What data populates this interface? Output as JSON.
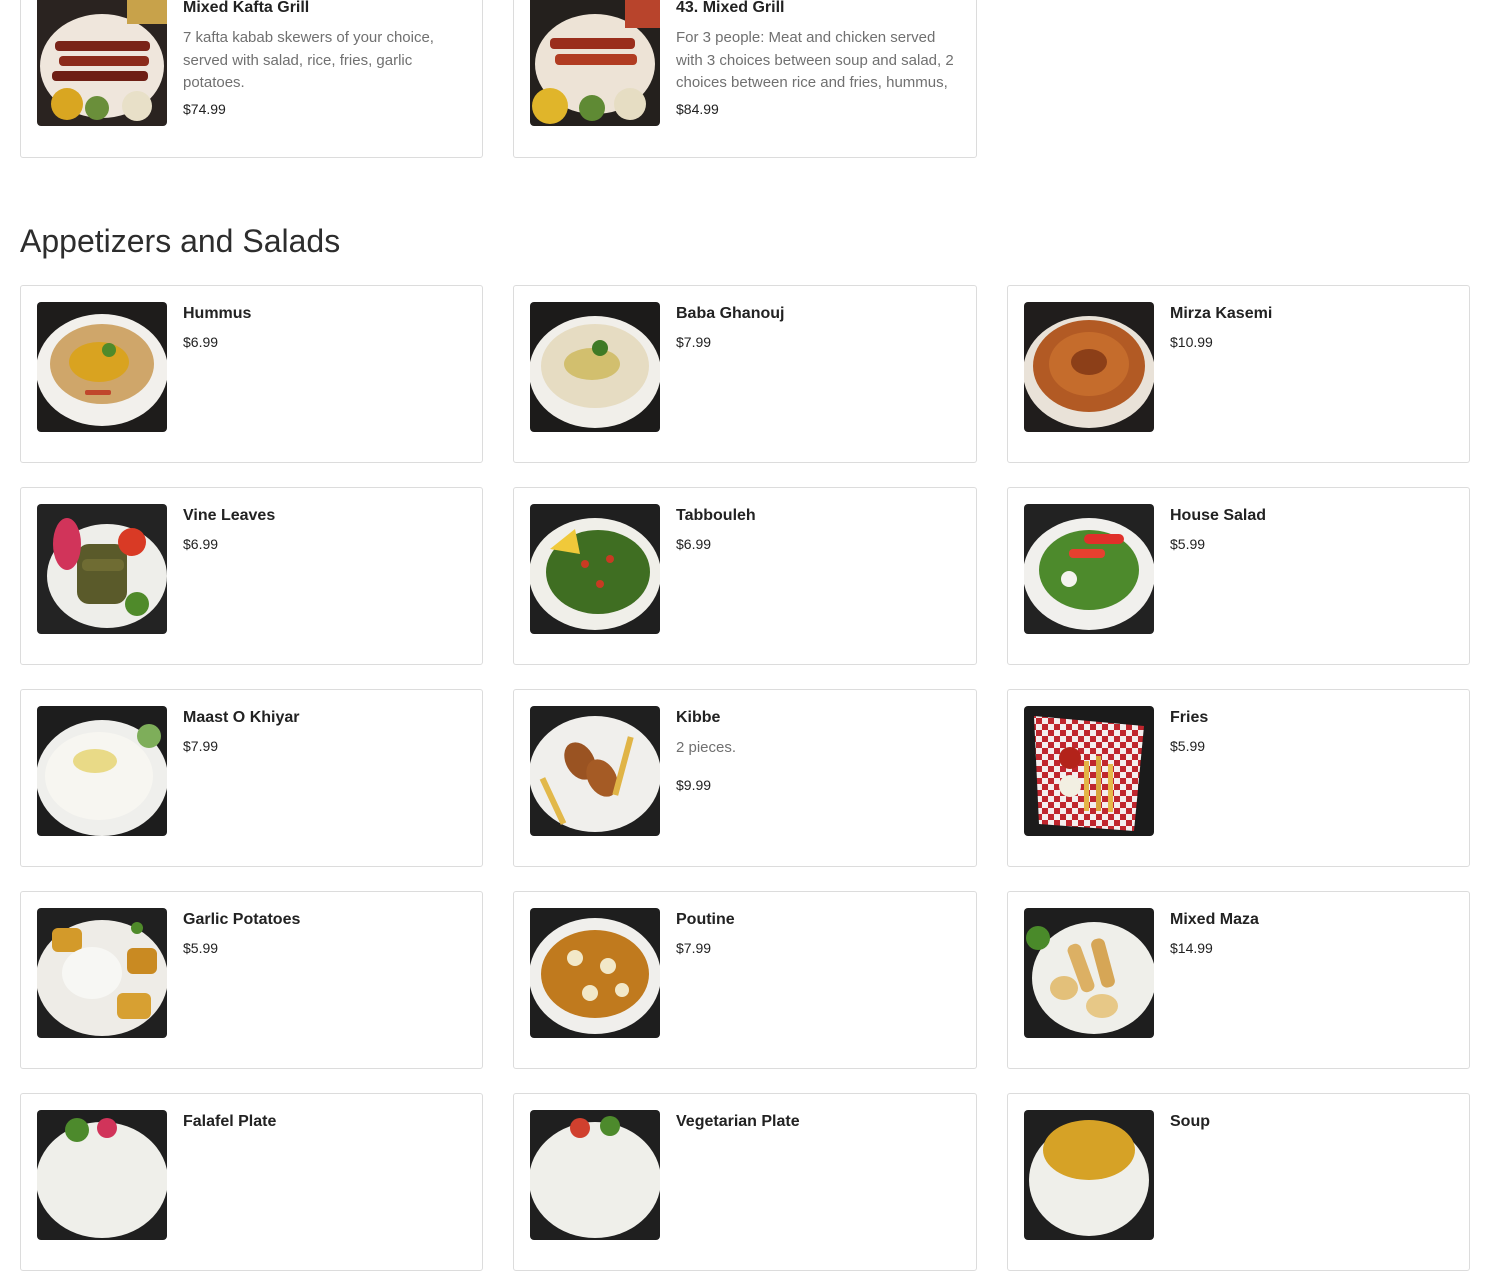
{
  "top_items": [
    {
      "name": "Mixed Kafta Grill",
      "description": "7 kafta kabab skewers of your choice, served with salad, rice, fries, garlic potatoes.",
      "price": "$74.99",
      "image_icon": "mixed-grill-platter-photo"
    },
    {
      "name": "43. Mixed Grill",
      "description": "For 3 people: Meat and chicken served with 3 choices between soup and salad, 2 choices between rice and fries, hummus, garlic potatoes.",
      "price": "$84.99",
      "image_icon": "mixed-grill-platter-photo"
    }
  ],
  "section": {
    "title": "Appetizers and Salads",
    "items": [
      {
        "name": "Hummus",
        "description": "",
        "price": "$6.99",
        "image_icon": "hummus-photo"
      },
      {
        "name": "Baba Ghanouj",
        "description": "",
        "price": "$7.99",
        "image_icon": "baba-ghanouj-photo"
      },
      {
        "name": "Mirza Kasemi",
        "description": "",
        "price": "$10.99",
        "image_icon": "mirza-kasemi-photo"
      },
      {
        "name": "Vine Leaves",
        "description": "",
        "price": "$6.99",
        "image_icon": "vine-leaves-photo"
      },
      {
        "name": "Tabbouleh",
        "description": "",
        "price": "$6.99",
        "image_icon": "tabbouleh-photo"
      },
      {
        "name": "House Salad",
        "description": "",
        "price": "$5.99",
        "image_icon": "house-salad-photo"
      },
      {
        "name": "Maast O Khiyar",
        "description": "",
        "price": "$7.99",
        "image_icon": "yogurt-dip-photo"
      },
      {
        "name": "Kibbe",
        "description": "2 pieces.",
        "price": "$9.99",
        "image_icon": "kibbe-photo"
      },
      {
        "name": "Fries",
        "description": "",
        "price": "$5.99",
        "image_icon": "fries-basket-photo"
      },
      {
        "name": "Garlic Potatoes",
        "description": "",
        "price": "$5.99",
        "image_icon": "garlic-potatoes-photo"
      },
      {
        "name": "Poutine",
        "description": "",
        "price": "$7.99",
        "image_icon": "poutine-photo"
      },
      {
        "name": "Mixed Maza",
        "description": "",
        "price": "$14.99",
        "image_icon": "mixed-maza-photo"
      },
      {
        "name": "Falafel Plate",
        "description": "",
        "price": "",
        "image_icon": "falafel-plate-photo"
      },
      {
        "name": "Vegetarian Plate",
        "description": "",
        "price": "",
        "image_icon": "vegetarian-plate-photo"
      },
      {
        "name": "Soup",
        "description": "",
        "price": "",
        "image_icon": "soup-photo"
      }
    ]
  },
  "colors": {
    "background": "#ffffff",
    "card_border": "#dcdcdc",
    "title_text": "#222222",
    "description_text": "#707070"
  }
}
